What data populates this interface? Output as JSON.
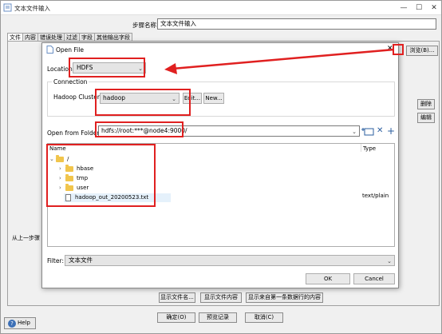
{
  "window": {
    "title": "文本文件输入",
    "controls": [
      "—",
      "☐",
      "✕"
    ]
  },
  "step": {
    "label": "步骤名称",
    "value": "文本文件输入"
  },
  "tabs": [
    "文件",
    "内容",
    "错误处理",
    "过滤",
    "字段",
    "其他输出字段"
  ],
  "right_buttons": {
    "browse": "浏览(B)...",
    "delete": "删除",
    "edit": "编辑"
  },
  "left_label": "从上一步骤",
  "bottom_buttons": [
    "显示文件名...",
    "显示文件内容",
    "显示来自第一条数据行的内容"
  ],
  "action_buttons": [
    "确定(O)",
    "预览记录",
    "取消(C)"
  ],
  "help": "Help",
  "dialog": {
    "title": "Open File",
    "location_label": "Location:",
    "location_value": "HDFS",
    "connection_legend": "Connection",
    "cluster_label": "Hadoop Cluster:",
    "cluster_value": "hadoop",
    "edit_button": "Edit...",
    "new_button": "New...",
    "folder_label": "Open from Folder:",
    "folder_value": "hdfs://root:***@node4:9000/",
    "col_name": "Name",
    "col_type": "Type",
    "tree": {
      "root": "/",
      "folders": [
        "hbase",
        "tmp",
        "user"
      ],
      "file": "hadoop_out_20200523.txt",
      "file_type": "text/plain"
    },
    "filter_label": "Filter:",
    "filter_value": "文本文件",
    "ok": "OK",
    "cancel": "Cancel"
  },
  "icons": {
    "new_folder": "new-folder-icon",
    "delete": "delete-icon",
    "add": "add-icon"
  },
  "colors": {
    "highlight": "#e02020",
    "folder": "#f1c54c"
  }
}
